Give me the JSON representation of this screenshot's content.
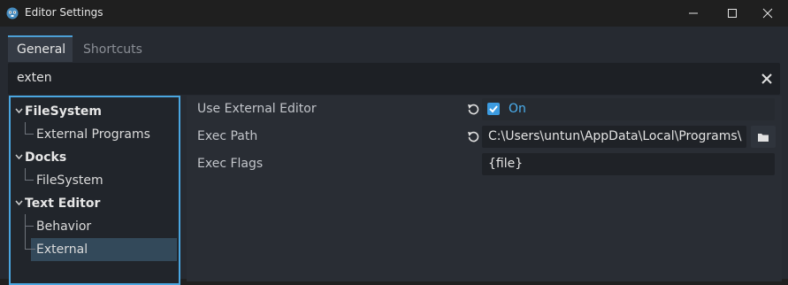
{
  "window": {
    "title": "Editor Settings",
    "icon": "godot-icon"
  },
  "tabs": [
    {
      "label": "General",
      "active": true
    },
    {
      "label": "Shortcuts",
      "active": false
    }
  ],
  "search": {
    "value": "exten"
  },
  "tree": {
    "items": [
      {
        "label": "FileSystem",
        "type": "category"
      },
      {
        "label": "External Programs",
        "type": "section"
      },
      {
        "label": "Docks",
        "type": "category"
      },
      {
        "label": "FileSystem",
        "type": "section"
      },
      {
        "label": "Text Editor",
        "type": "category"
      },
      {
        "label": "Behavior",
        "type": "section"
      },
      {
        "label": "External",
        "type": "section",
        "selected": true
      }
    ]
  },
  "settings": {
    "use_external_editor": {
      "label": "Use External Editor",
      "checked": true,
      "value": "On"
    },
    "exec_path": {
      "label": "Exec Path",
      "value": "C:\\Users\\untun\\AppData\\Local\\Programs\\"
    },
    "exec_flags": {
      "label": "Exec Flags",
      "value": "{file}"
    }
  },
  "colors": {
    "accent": "#4aa6e0",
    "on_text": "#4bb0f0",
    "selected_row": "#33495a"
  }
}
